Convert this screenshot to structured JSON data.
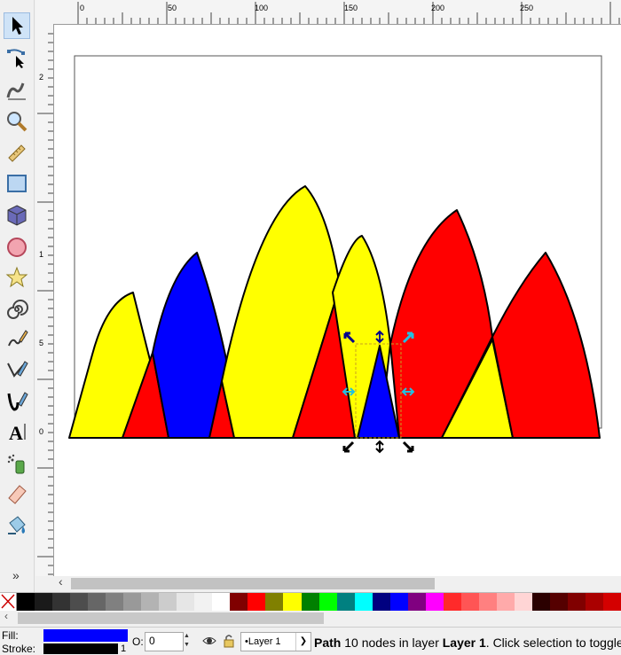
{
  "toolbox": {
    "tools": [
      {
        "name": "selector-tool-icon",
        "active": true
      },
      {
        "name": "node-tool-icon",
        "active": false
      },
      {
        "name": "tweak-tool-icon",
        "active": false
      },
      {
        "name": "zoom-tool-icon",
        "active": false
      },
      {
        "name": "measure-tool-icon",
        "active": false
      },
      {
        "name": "rectangle-tool-icon",
        "active": false
      },
      {
        "name": "3d-box-tool-icon",
        "active": false
      },
      {
        "name": "ellipse-tool-icon",
        "active": false
      },
      {
        "name": "star-tool-icon",
        "active": false
      },
      {
        "name": "spiral-tool-icon",
        "active": false
      },
      {
        "name": "pencil-tool-icon",
        "active": false
      },
      {
        "name": "pen-tool-icon",
        "active": false
      },
      {
        "name": "calligraphy-tool-icon",
        "active": false
      },
      {
        "name": "text-tool-icon",
        "active": false
      },
      {
        "name": "spray-tool-icon",
        "active": false
      },
      {
        "name": "eraser-tool-icon",
        "active": false
      },
      {
        "name": "paint-bucket-tool-icon",
        "active": false
      }
    ],
    "more_label": "»"
  },
  "hruler": {
    "labels": [
      "0",
      "50",
      "100",
      "150",
      "200",
      "250"
    ]
  },
  "vruler": {
    "labels": [
      "2",
      "1",
      "5",
      "0"
    ]
  },
  "palette": {
    "colors": [
      "#000000",
      "#1a1a1a",
      "#333333",
      "#4d4d4d",
      "#666666",
      "#808080",
      "#999999",
      "#b3b3b3",
      "#cccccc",
      "#e6e6e6",
      "#f2f2f2",
      "#ffffff",
      "#800000",
      "#ff0000",
      "#808000",
      "#ffff00",
      "#008000",
      "#00ff00",
      "#008080",
      "#00ffff",
      "#000080",
      "#0000ff",
      "#800080",
      "#ff00ff",
      "#ff2a2a",
      "#ff5555",
      "#ff8080",
      "#ffaaaa",
      "#ffd5d5",
      "#2b0000",
      "#550000",
      "#800000",
      "#aa0000",
      "#d40000"
    ]
  },
  "status": {
    "fill_label": "Fill:",
    "stroke_label": "Stroke:",
    "fill_color": "#0000ff",
    "stroke_color": "#000000",
    "stroke_width": "1",
    "opacity_label": "O:",
    "opacity_value": "0",
    "layer_name": "•Layer 1",
    "message": {
      "object": "Path",
      "detail": " 10 nodes in layer ",
      "layer": "Layer 1",
      "hint": ". Click selection to toggle"
    }
  }
}
